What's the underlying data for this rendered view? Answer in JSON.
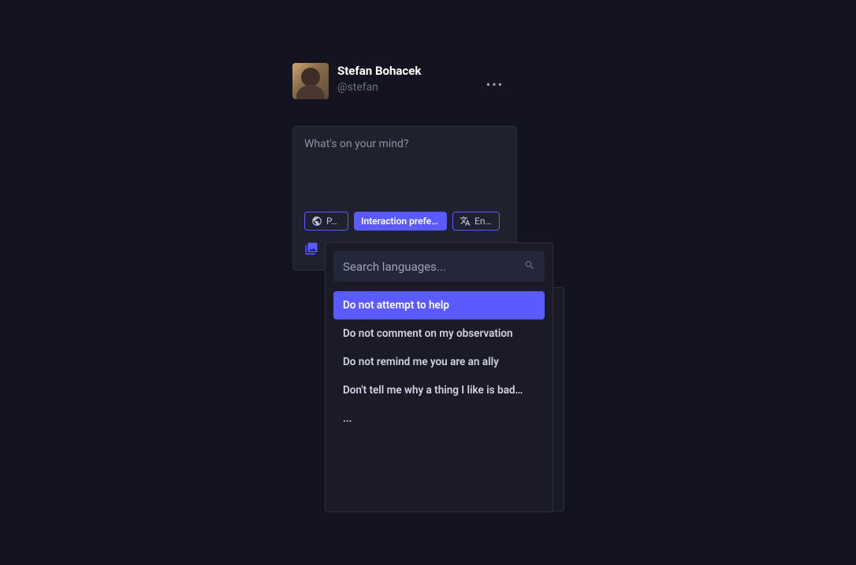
{
  "user": {
    "display_name": "Stefan Bohacek",
    "handle": "@stefan"
  },
  "compose": {
    "placeholder": "What's on your mind?",
    "privacy_label": "P…",
    "interaction_label": "Interaction prefe…",
    "language_label": "En…"
  },
  "dropdown": {
    "search_placeholder": "Search languages...",
    "options": [
      "Do not attempt to help",
      "Do not comment on my observation",
      "Do not remind me you are an ally",
      "Don't tell me why a thing I like is bad…",
      "..."
    ]
  }
}
